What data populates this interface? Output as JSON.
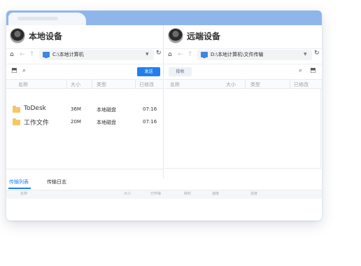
{
  "left_pane": {
    "title": "本地设备",
    "path": "C:\\本地计算机",
    "send_label": "发送",
    "columns": [
      "名称",
      "大小",
      "类型",
      "已修改"
    ],
    "files": [
      {
        "name": "ToDesk",
        "size": "36M",
        "type": "本地磁盘",
        "modified": "07:16"
      },
      {
        "name": "工作文件",
        "size": "20M",
        "type": "本地磁盘",
        "modified": "07:16"
      }
    ]
  },
  "right_pane": {
    "title": "远端设备",
    "path": "D:\\本地计算机\\文件传输",
    "receive_label": "接收",
    "columns": [
      "名称",
      "大小",
      "类型",
      "已修改"
    ]
  },
  "bottom": {
    "tabs": [
      "传输列表",
      "传输日志"
    ],
    "columns": [
      "名称",
      "大小",
      "已传输",
      "耗时",
      "速度",
      "进度"
    ]
  },
  "colors": {
    "accent": "#1f7ff0",
    "titlebar": "#8fb6ea",
    "folder": "#f3c868"
  },
  "icons": [
    "home-icon",
    "back-arrow-icon",
    "forward-arrow-icon",
    "up-arrow-icon",
    "computer-icon",
    "chevron-down-icon",
    "refresh-icon",
    "upload-folder-icon",
    "search-icon",
    "folder-icon"
  ]
}
